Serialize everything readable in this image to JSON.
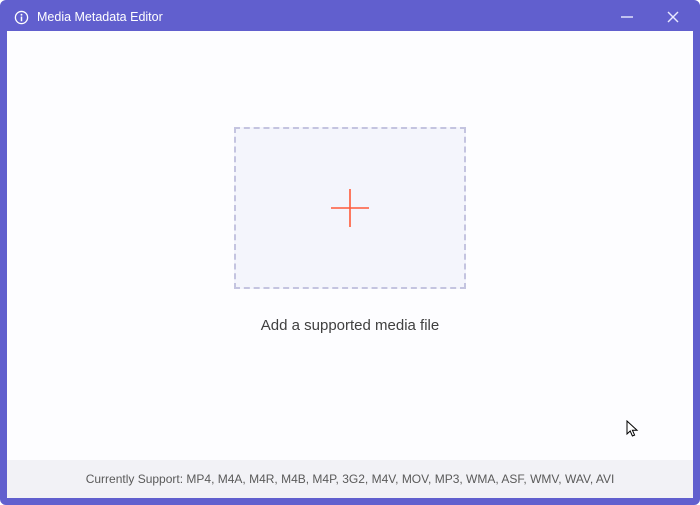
{
  "titlebar": {
    "app_title": "Media Metadata Editor"
  },
  "main": {
    "prompt": "Add a supported media file"
  },
  "footer": {
    "supported_text": "Currently Support: MP4, M4A, M4R, M4B, M4P, 3G2, M4V, MOV, MP3, WMA, ASF, WMV, WAV, AVI"
  },
  "icons": {
    "app": "info-icon",
    "minimize": "minimize-icon",
    "close": "close-icon",
    "add": "plus-icon"
  },
  "colors": {
    "accent": "#615fce",
    "dropzone_bg": "#f4f5fc",
    "dropzone_border": "#c4c4e0",
    "plus": "#ff5a3a",
    "footer_bg": "#f2f2f6"
  }
}
